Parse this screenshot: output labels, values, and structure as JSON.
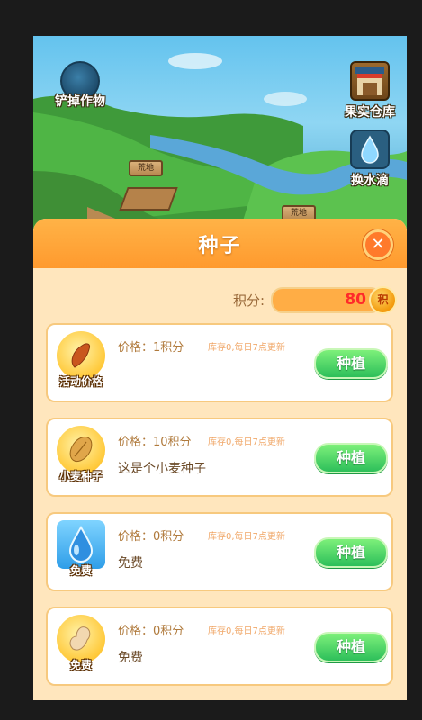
{
  "scene": {
    "tools": {
      "shovel": "铲掉作物",
      "store": "果实仓库",
      "store_sign": "果实仓库",
      "water": "换水滴"
    },
    "plots": [
      "荒地",
      "荒地"
    ]
  },
  "panel": {
    "title": "种子",
    "score_label": "积分:",
    "score_value": "80",
    "score_coin": "积"
  },
  "seeds": [
    {
      "tag": "活动价格",
      "price": "价格：1积分",
      "stock": "库存0,每日7点更新",
      "desc": "",
      "action": "种植",
      "icon": "sweet-potato-icon"
    },
    {
      "tag": "小麦种子",
      "price": "价格：10积分",
      "stock": "库存0,每日7点更新",
      "desc": "这是个小麦种子",
      "action": "种植",
      "icon": "wheat-seed-icon"
    },
    {
      "tag": "免费",
      "price": "价格：0积分",
      "stock": "库存0,每日7点更新",
      "desc": "免费",
      "action": "种植",
      "icon": "water-drop-icon"
    },
    {
      "tag": "免费",
      "price": "价格：0积分",
      "stock": "库存0,每日7点更新",
      "desc": "免费",
      "action": "种植",
      "icon": "peanut-icon"
    }
  ],
  "colors": {
    "accent": "#ff9a2e",
    "plant_button": "#2dbf5a",
    "score_text": "#ff2a2a"
  }
}
